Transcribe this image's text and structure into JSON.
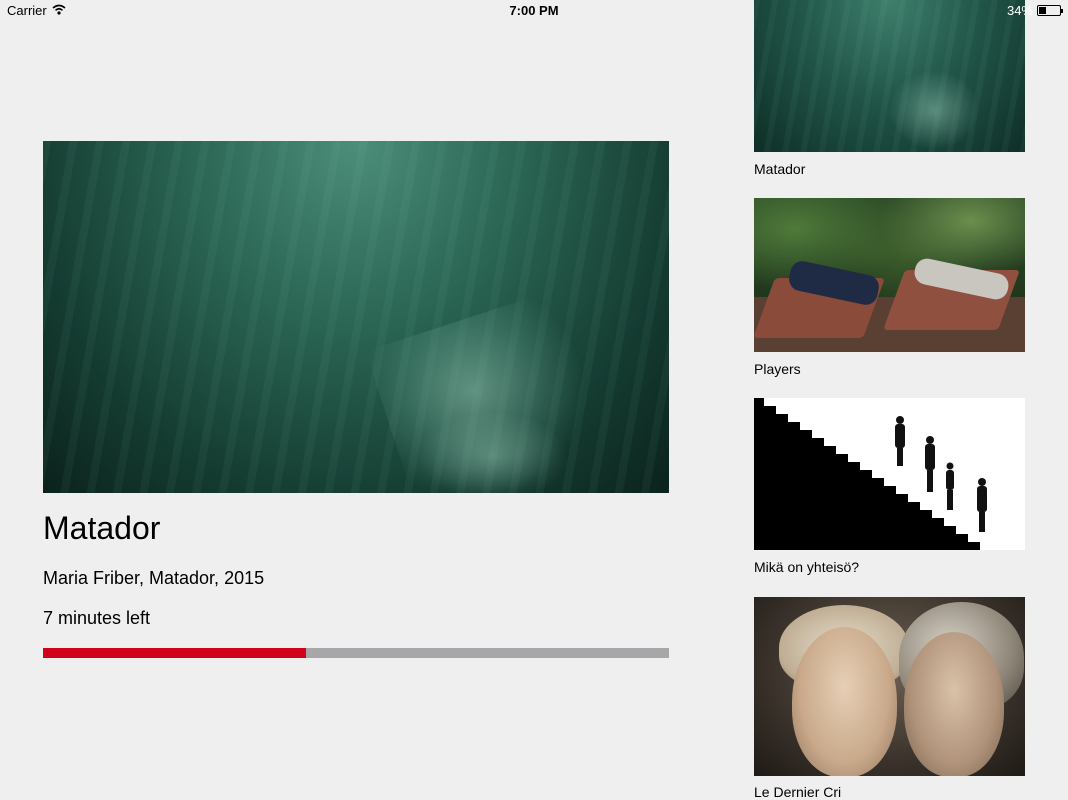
{
  "status_bar": {
    "carrier": "Carrier",
    "time": "7:00 PM",
    "battery_text": "34%",
    "battery_level": 0.34,
    "wifi_icon": "wifi-icon",
    "battery_icon": "battery-icon"
  },
  "player": {
    "title": "Matador",
    "subtitle": "Maria Friber, Matador, 2015",
    "time_left": "7 minutes left",
    "progress": 0.42,
    "progress_color": "#d0021b",
    "track_color": "#a7a7aa"
  },
  "playlist": {
    "items": [
      {
        "label": "Matador"
      },
      {
        "label": "Players"
      },
      {
        "label": "Mikä on yhteisö?"
      },
      {
        "label": "Le Dernier Cri"
      }
    ]
  }
}
